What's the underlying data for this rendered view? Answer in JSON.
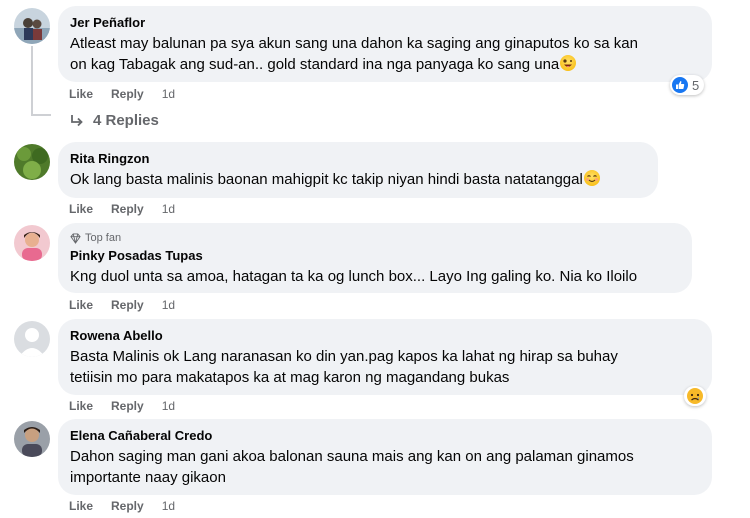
{
  "comments": [
    {
      "name": "Jer Peñaflor",
      "lines": [
        "Atleast may balunan pa sya akun sang una dahon ka saging ang ginaputos ko sa kan",
        "on kag Tabagak ang sud-an.. gold standard ina nga panyaga ko sang una"
      ],
      "emoji": "crazy-face-emoji",
      "like": "Like",
      "reply": "Reply",
      "time": "1d",
      "reaction_icon": "like-reaction-icon",
      "reaction_count": "5",
      "replies_label": "4 Replies"
    },
    {
      "name": "Rita Ringzon",
      "lines": [
        "Ok lang basta malinis baonan mahigpit kc takip niyan hindi basta natatanggal"
      ],
      "emoji": "blush-smile-emoji",
      "like": "Like",
      "reply": "Reply",
      "time": "1d"
    },
    {
      "badge": "Top fan",
      "badge_icon": "diamond-icon",
      "name": "Pinky Posadas Tupas",
      "lines": [
        "Kng duol unta sa amoa, hatagan ta ka og lunch box... Layo Ing galing ko. Nia ko Iloilo"
      ],
      "like": "Like",
      "reply": "Reply",
      "time": "1d"
    },
    {
      "name": "Rowena Abello",
      "lines": [
        "Basta Malinis ok Lang naranasan ko din yan.pag kapos ka lahat ng hirap sa buhay",
        "tetiisin mo para makatapos ka at mag karon ng magandang bukas"
      ],
      "like": "Like",
      "reply": "Reply",
      "time": "1d",
      "reaction_icon": "sad-reaction-icon"
    },
    {
      "name": "Elena Cañaberal Credo",
      "lines": [
        "Dahon saging man gani akoa balonan sauna mais ang kan on ang palaman ginamos",
        "importante naay gikaon"
      ],
      "like": "Like",
      "reply": "Reply",
      "time": "1d"
    }
  ],
  "colors": {
    "bubble": "#f0f2f5",
    "secondary_text": "#65676b",
    "like_blue": "#1877f2"
  }
}
